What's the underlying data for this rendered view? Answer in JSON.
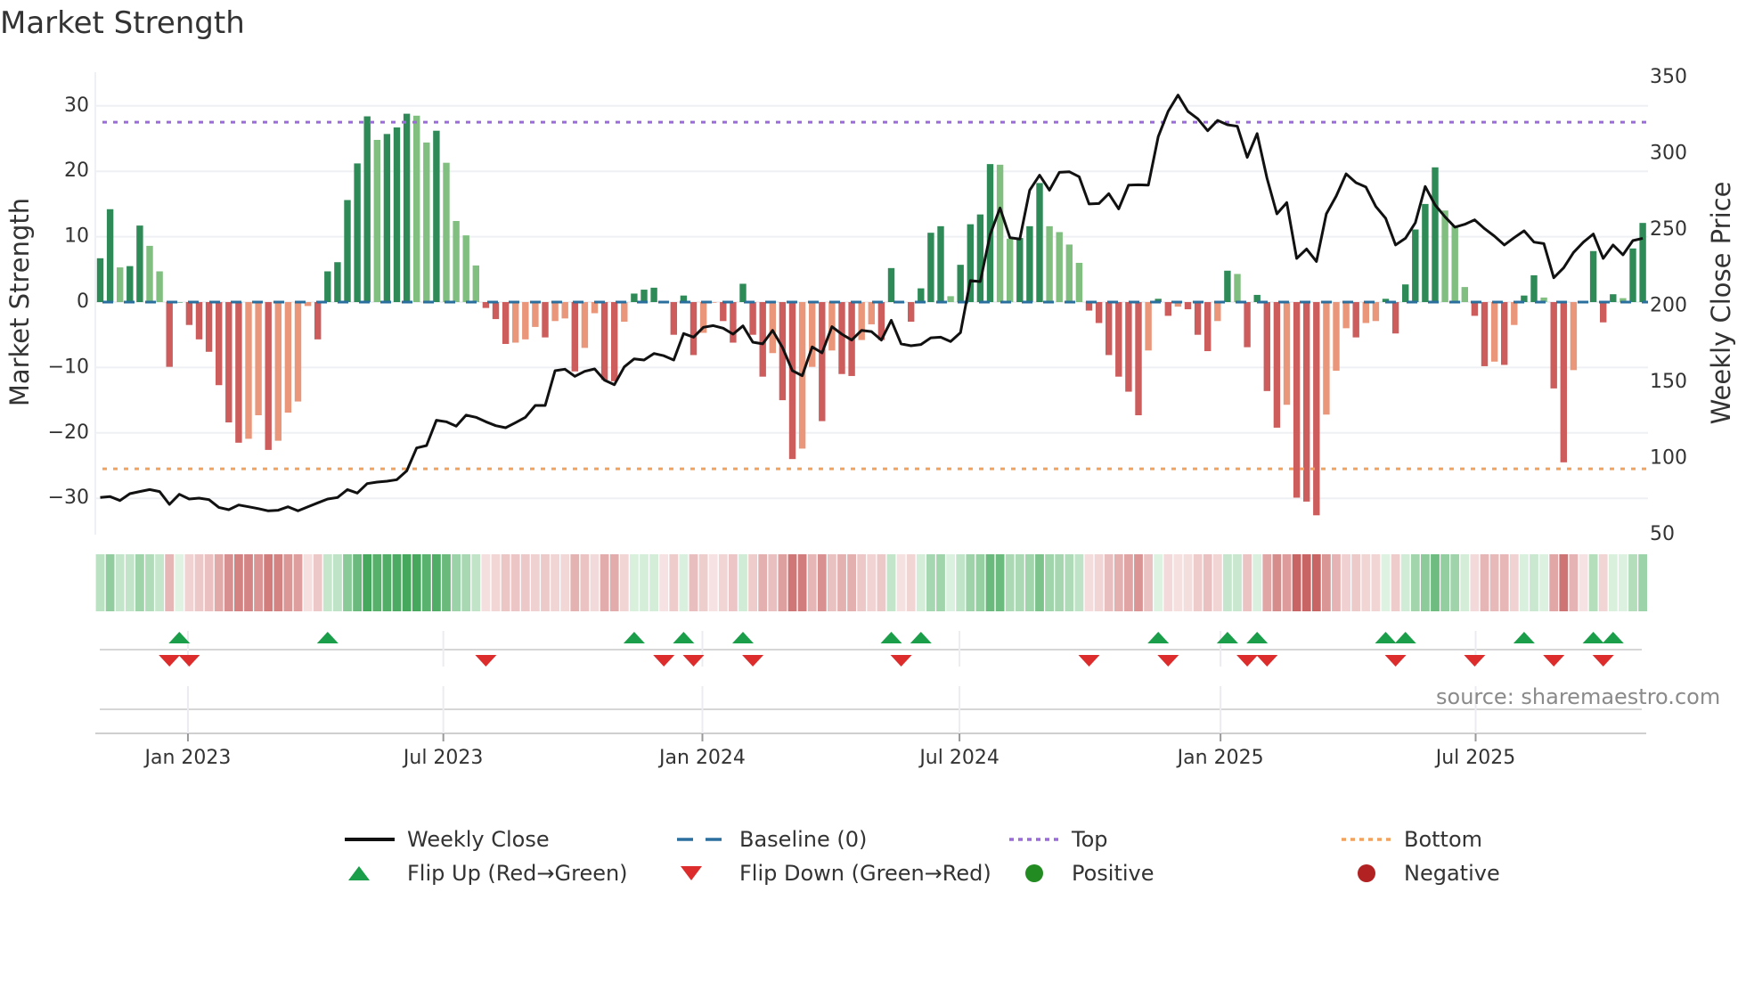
{
  "title": "Market Strength",
  "source": "source: sharemaestro.com",
  "colors": {
    "bar_pos_strong": "#2e8b57",
    "bar_pos_weak": "#80bf80",
    "bar_neg_strong": "#cd5c5c",
    "bar_neg_weak": "#e9967a",
    "close_line": "#111111",
    "baseline": "#2a6f9e",
    "top_line": "#9b6bdc",
    "bottom_line": "#f0a25e",
    "flip_up": "#1a9e4a",
    "flip_down": "#dd2c2c",
    "positive": "#228b22",
    "negative": "#b22222"
  },
  "legend": [
    {
      "key": "close",
      "label": "Weekly Close"
    },
    {
      "key": "baseline",
      "label": "Baseline (0)"
    },
    {
      "key": "top",
      "label": "Top"
    },
    {
      "key": "bottom",
      "label": "Bottom"
    },
    {
      "key": "flip_up",
      "label": "Flip Up (Red→Green)"
    },
    {
      "key": "flip_down",
      "label": "Flip Down (Green→Red)"
    },
    {
      "key": "positive",
      "label": "Positive"
    },
    {
      "key": "negative",
      "label": "Negative"
    }
  ],
  "chart_data": {
    "type": "bar",
    "title": "Market Strength",
    "ylabel": "Market Strength",
    "ylabel_right": "Weekly Close Price",
    "ylim": [
      -35,
      35
    ],
    "ylim_right": [
      50,
      350
    ],
    "yticks": [
      30,
      20,
      10,
      0,
      -10,
      -20,
      -30
    ],
    "yticks_labels": [
      "30",
      "20",
      "10",
      "0",
      "−10",
      "−20",
      "−30"
    ],
    "yticks_right": [
      350,
      300,
      250,
      200,
      150,
      100,
      50
    ],
    "yticks_right_labels": [
      "350",
      "300",
      "250",
      "200",
      "150",
      "100",
      "50"
    ],
    "top_level": 27.5,
    "bottom_level": -25.5,
    "baseline": 0,
    "x_ticks": [
      {
        "week": 8.87,
        "label": "Jan 2023"
      },
      {
        "week": 34.7,
        "label": "Jul 2023"
      },
      {
        "week": 60.9,
        "label": "Jan 2024"
      },
      {
        "week": 86.9,
        "label": "Jul 2024"
      },
      {
        "week": 113.3,
        "label": "Jan 2025"
      },
      {
        "week": 139.1,
        "label": "Jul 2025"
      }
    ],
    "strength": [
      6.7,
      14.2,
      5.3,
      5.5,
      11.7,
      8.6,
      4.7,
      -9.9,
      0,
      -3.5,
      -5.7,
      -7.6,
      -12.7,
      -18.4,
      -21.5,
      -20.9,
      -17.3,
      -22.6,
      -21.2,
      -16.9,
      -15.2,
      -0.6,
      -5.7,
      4.7,
      6.1,
      15.6,
      21.2,
      28.4,
      24.8,
      25.7,
      26.7,
      28.8,
      28.5,
      24.4,
      26.2,
      21.3,
      12.4,
      10.2,
      5.6,
      -0.9,
      -2.6,
      -6.4,
      -6.2,
      -5.7,
      -3.8,
      -5.4,
      -2.9,
      -2.5,
      -10.6,
      -7.0,
      -1.7,
      -11.9,
      -12.1,
      -3.0,
      1.3,
      1.9,
      2.2,
      -0.1,
      -5.0,
      1.0,
      -8.1,
      -4.7,
      -0.1,
      -2.9,
      -6.2,
      2.8,
      -5.0,
      -11.4,
      -7.8,
      -15.0,
      -24.0,
      -22.4,
      -9.9,
      -18.2,
      -7.4,
      -11.0,
      -11.3,
      -5.8,
      -3.4,
      -5.8,
      5.2,
      -0.2,
      -3.0,
      2.1,
      10.6,
      11.6,
      0.9,
      5.7,
      11.9,
      13.4,
      21.1,
      21.0,
      9.7,
      9.8,
      11.6,
      18.2,
      11.6,
      10.7,
      8.8,
      6.0,
      -1.3,
      -3.2,
      -8.1,
      -11.4,
      -13.7,
      -17.3,
      -7.4,
      0.5,
      -2.1,
      -0.7,
      -1.1,
      -5.0,
      -7.5,
      -2.9,
      4.8,
      4.3,
      -6.9,
      1.1,
      -13.6,
      -19.2,
      -15.7,
      -29.9,
      -30.5,
      -32.6,
      -17.2,
      -10.5,
      -4.0,
      -5.4,
      -3.2,
      -2.9,
      0.5,
      -4.8,
      2.7,
      11.1,
      15.0,
      20.6,
      14.0,
      11.7,
      2.3,
      -2.1,
      -9.8,
      -9.1,
      -9.6,
      -3.5,
      1.0,
      4.1,
      0.7,
      -13.2,
      -24.5,
      -10.4,
      -0.1,
      7.8,
      -3.1,
      1.2,
      0.6,
      8.2,
      12.1
    ],
    "weekly_close": [
      74.4,
      75.0,
      72.4,
      76.9,
      78.3,
      79.6,
      78.3,
      69.9,
      76.5,
      73.4,
      74.0,
      73.0,
      67.9,
      66.4,
      69.5,
      68.3,
      67.1,
      65.6,
      66.0,
      68.3,
      65.6,
      68.3,
      70.9,
      73.4,
      74.4,
      79.6,
      77.3,
      83.5,
      84.5,
      85.1,
      86.1,
      91.9,
      106.9,
      108.5,
      125.1,
      124.1,
      121.2,
      128.4,
      127.0,
      124.1,
      121.5,
      120.2,
      123.5,
      127.0,
      134.8,
      134.8,
      157.6,
      158.6,
      153.9,
      157.2,
      158.8,
      151.4,
      148.4,
      160.1,
      165.4,
      164.6,
      168.9,
      167.4,
      164.6,
      182.0,
      179.6,
      186.1,
      187.2,
      185.5,
      181.6,
      187.0,
      176.3,
      175.2,
      184.1,
      172.8,
      157.6,
      154.3,
      173.2,
      169.3,
      186.5,
      181.6,
      177.7,
      184.1,
      183.3,
      177.7,
      190.7,
      175.2,
      174.0,
      174.8,
      179.2,
      179.6,
      176.7,
      182.6,
      216.7,
      216.1,
      246.9,
      264.4,
      244.9,
      244.0,
      276.1,
      285.9,
      276.1,
      287.8,
      288.2,
      284.9,
      267.0,
      267.3,
      273.8,
      263.8,
      279.4,
      279.6,
      279.4,
      311.2,
      327.8,
      338.5,
      327.8,
      322.9,
      315.1,
      321.9,
      319.0,
      318.0,
      297.6,
      313.2,
      283.9,
      260.5,
      267.9,
      231.3,
      237.5,
      229.3,
      260.5,
      272.2,
      286.8,
      281.0,
      278.1,
      265.4,
      257.6,
      240.1,
      244.5,
      254.7,
      278.5,
      266.4,
      258.6,
      251.8,
      253.7,
      256.6,
      250.8,
      245.9,
      240.1,
      244.9,
      249.4,
      242.0,
      241.0,
      218.6,
      225.1,
      235.2,
      242.0,
      247.3,
      231.3,
      240.1,
      233.6,
      243.0,
      244.5
    ]
  }
}
